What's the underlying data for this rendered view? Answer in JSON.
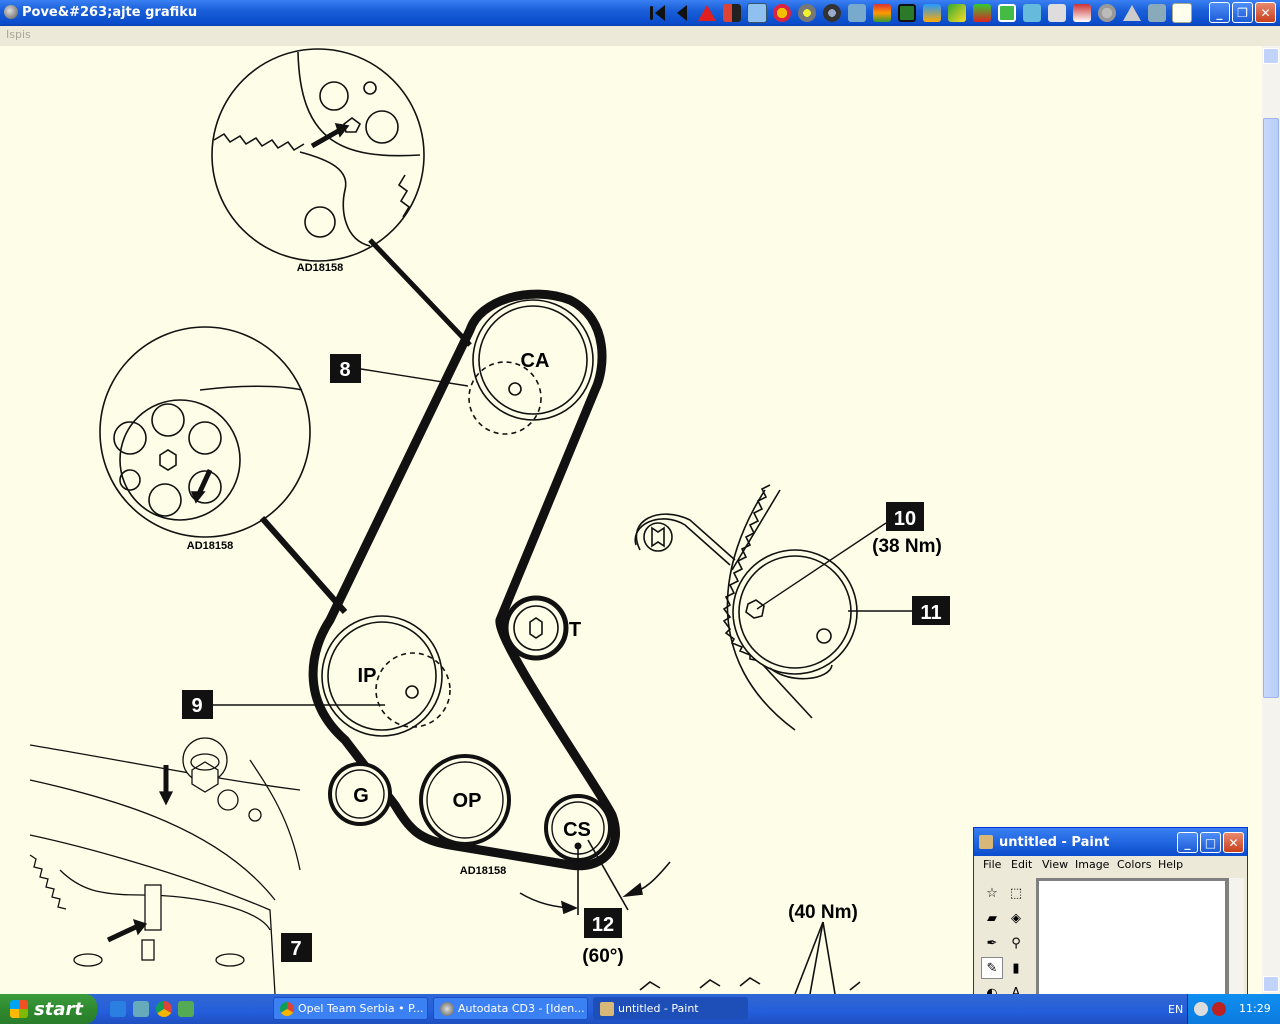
{
  "window": {
    "title": "Pove&#263;ajte grafiku",
    "menu": [
      "Ispis"
    ]
  },
  "diagram": {
    "ref_codes": [
      "AD18158",
      "AD18158",
      "AD18158"
    ],
    "pulleys": [
      "CA",
      "IP",
      "T",
      "G",
      "OP",
      "CS"
    ],
    "callouts": [
      "7",
      "8",
      "9",
      "10",
      "11",
      "12"
    ],
    "torques": [
      "(38 Nm)",
      "(40 Nm)"
    ],
    "angle": "(60°)"
  },
  "paint": {
    "title": "untitled - Paint",
    "menu": [
      "File",
      "Edit",
      "View",
      "Image",
      "Colors",
      "Help"
    ]
  },
  "taskbar": {
    "start": "start",
    "tasks": [
      "Opel Team Serbia • P...",
      "Autodata CD3 - [Iden...",
      "untitled - Paint"
    ],
    "lang": "EN",
    "clock": "11:29"
  }
}
